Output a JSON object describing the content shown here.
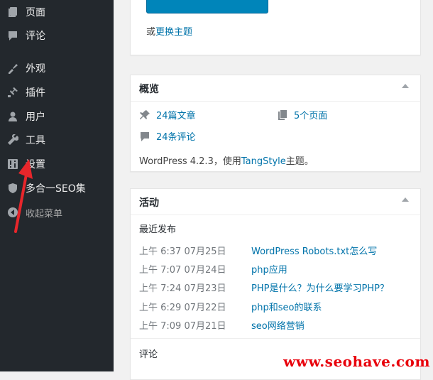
{
  "sidebar": {
    "items": [
      {
        "label": "页面",
        "icon": "pages-icon"
      },
      {
        "label": "评论",
        "icon": "comments-icon"
      },
      {
        "label": "外观",
        "icon": "appearance-icon"
      },
      {
        "label": "插件",
        "icon": "plugins-icon"
      },
      {
        "label": "用户",
        "icon": "users-icon"
      },
      {
        "label": "工具",
        "icon": "tools-icon"
      },
      {
        "label": "设置",
        "icon": "settings-icon"
      },
      {
        "label": "多合一SEO集",
        "icon": "shield-icon"
      },
      {
        "label": "收起菜单",
        "icon": "collapse-icon"
      }
    ]
  },
  "top_panel": {
    "or_text": "或",
    "change_theme_link": "更换主题"
  },
  "overview": {
    "title": "概览",
    "posts": "24篇文章",
    "pages": "5个页面",
    "comments": "24条评论",
    "version_prefix": "WordPress 4.2.3，使用",
    "theme": "TangStyle",
    "version_suffix": "主题。"
  },
  "activity": {
    "title": "活动",
    "recent_label": "最近发布",
    "posts": [
      {
        "date": "上午 6:37 07月25日",
        "title": "WordPress Robots.txt怎么写"
      },
      {
        "date": "上午 7:07 07月24日",
        "title": "php应用"
      },
      {
        "date": "上午 7:24 07月23日",
        "title": "PHP是什么？为什么要学习PHP？"
      },
      {
        "date": "上午 6:29 07月22日",
        "title": "php和seo的联系"
      },
      {
        "date": "上午 7:09 07月21日",
        "title": "seo网络营销"
      }
    ],
    "comments_label": "评论"
  },
  "watermark": "www.seohave.com",
  "colors": {
    "sidebar_bg": "#23282d",
    "link": "#0073aa",
    "button": "#0085ba",
    "arrow": "#e8262b"
  }
}
